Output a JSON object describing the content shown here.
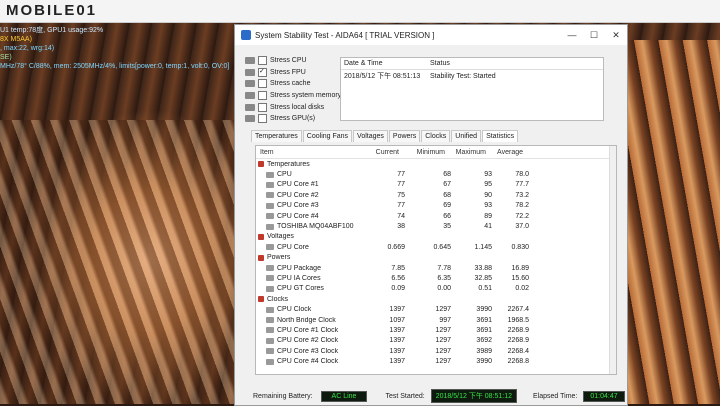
{
  "watermark": "MOBILE01",
  "osd": {
    "line0": "U1 temp:78度, GPU1 usage:92%",
    "line1": "8X M5AA)",
    "line2": ", max:22, wrg:14)",
    "line3": "SE)",
    "line4": "MHz/78° C/88%, mem: 2505MHz/4%, limits[power:0, temp:1, volt:0, OV:0]"
  },
  "window": {
    "title": "System Stability Test - AIDA64  [ TRIAL VERSION ]",
    "minimize": "—",
    "maximize": "☐",
    "close": "✕"
  },
  "stress_options": [
    {
      "label": "Stress CPU",
      "checked": false
    },
    {
      "label": "Stress FPU",
      "checked": true
    },
    {
      "label": "Stress cache",
      "checked": false
    },
    {
      "label": "Stress system memory",
      "checked": false
    },
    {
      "label": "Stress local disks",
      "checked": false
    },
    {
      "label": "Stress GPU(s)",
      "checked": false
    }
  ],
  "status_box": {
    "col_date": "Date & Time",
    "col_status": "Status",
    "row_date": "2018/5/12 下午 08:51:13",
    "row_status": "Stability Test: Started"
  },
  "tabs": [
    "Temperatures",
    "Cooling Fans",
    "Voltages",
    "Powers",
    "Clocks",
    "Unified",
    "Statistics"
  ],
  "active_tab": "Statistics",
  "stats": {
    "headers": {
      "item": "Item",
      "current": "Current",
      "minimum": "Minimum",
      "maximum": "Maximum",
      "average": "Average"
    },
    "rows": [
      {
        "type": "group",
        "item": "Temperatures"
      },
      {
        "type": "item",
        "item": "CPU",
        "current": "77",
        "minimum": "68",
        "maximum": "93",
        "average": "78.0"
      },
      {
        "type": "item",
        "item": "CPU Core #1",
        "current": "77",
        "minimum": "67",
        "maximum": "95",
        "average": "77.7"
      },
      {
        "type": "item",
        "item": "CPU Core #2",
        "current": "75",
        "minimum": "68",
        "maximum": "90",
        "average": "73.2"
      },
      {
        "type": "item",
        "item": "CPU Core #3",
        "current": "77",
        "minimum": "69",
        "maximum": "93",
        "average": "78.2"
      },
      {
        "type": "item",
        "item": "CPU Core #4",
        "current": "74",
        "minimum": "66",
        "maximum": "89",
        "average": "72.2"
      },
      {
        "type": "item",
        "item": "TOSHIBA MQ04ABF100",
        "current": "38",
        "minimum": "35",
        "maximum": "41",
        "average": "37.0"
      },
      {
        "type": "group",
        "item": "Voltages"
      },
      {
        "type": "item",
        "item": "CPU Core",
        "current": "0.669",
        "minimum": "0.645",
        "maximum": "1.145",
        "average": "0.830"
      },
      {
        "type": "group",
        "item": "Powers"
      },
      {
        "type": "item",
        "item": "CPU Package",
        "current": "7.85",
        "minimum": "7.78",
        "maximum": "33.88",
        "average": "16.89"
      },
      {
        "type": "item",
        "item": "CPU IA Cores",
        "current": "6.56",
        "minimum": "6.35",
        "maximum": "32.85",
        "average": "15.60"
      },
      {
        "type": "item",
        "item": "CPU GT Cores",
        "current": "0.09",
        "minimum": "0.00",
        "maximum": "0.51",
        "average": "0.02"
      },
      {
        "type": "group",
        "item": "Clocks"
      },
      {
        "type": "item",
        "item": "CPU Clock",
        "current": "1397",
        "minimum": "1297",
        "maximum": "3990",
        "average": "2267.4"
      },
      {
        "type": "item",
        "item": "North Bridge Clock",
        "current": "1097",
        "minimum": "997",
        "maximum": "3691",
        "average": "1968.5"
      },
      {
        "type": "item",
        "item": "CPU Core #1 Clock",
        "current": "1397",
        "minimum": "1297",
        "maximum": "3691",
        "average": "2268.9"
      },
      {
        "type": "item",
        "item": "CPU Core #2 Clock",
        "current": "1397",
        "minimum": "1297",
        "maximum": "3692",
        "average": "2268.9"
      },
      {
        "type": "item",
        "item": "CPU Core #3 Clock",
        "current": "1397",
        "minimum": "1297",
        "maximum": "3989",
        "average": "2268.4"
      },
      {
        "type": "item",
        "item": "CPU Core #4 Clock",
        "current": "1397",
        "minimum": "1297",
        "maximum": "3990",
        "average": "2268.8"
      }
    ]
  },
  "footer": {
    "battery_label": "Remaining Battery:",
    "battery_value": "AC Line",
    "test_started_label": "Test Started:",
    "test_started_value": "2018/5/12 下午 08:51:12",
    "elapsed_label": "Elapsed Time:",
    "elapsed_value": "01:04:47"
  }
}
